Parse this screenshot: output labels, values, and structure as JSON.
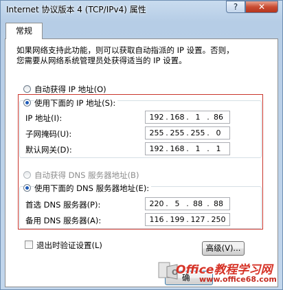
{
  "window": {
    "title": "Internet 协议版本 4 (TCP/IPv4) 属性",
    "help_label": "?",
    "close_label": "✕"
  },
  "tabs": [
    {
      "label": "常规"
    }
  ],
  "description": {
    "line1": "如果网络支持此功能，则可以获取自动指派的 IP 设置。否则，",
    "line2": "您需要从网络系统管理员处获得适当的 IP 设置。"
  },
  "ip_section": {
    "auto_label": "自动获得 IP 地址(O)",
    "manual_label": "使用下面的 IP 地址(S):",
    "selected": "manual",
    "fields": [
      {
        "label": "IP 地址(I):",
        "octets": [
          "192",
          "168",
          "1",
          "86"
        ]
      },
      {
        "label": "子网掩码(U):",
        "octets": [
          "255",
          "255",
          "255",
          "0"
        ]
      },
      {
        "label": "默认网关(D):",
        "octets": [
          "192",
          "168",
          "1",
          "1"
        ]
      }
    ]
  },
  "dns_section": {
    "auto_label": "自动获得 DNS 服务器地址(B)",
    "manual_label": "使用下面的 DNS 服务器地址(E):",
    "selected": "manual",
    "fields": [
      {
        "label": "首选 DNS 服务器(P):",
        "octets": [
          "220",
          "5",
          "88",
          "88"
        ]
      },
      {
        "label": "备用 DNS 服务器(A):",
        "octets": [
          "116",
          "199",
          "127",
          "250"
        ]
      }
    ]
  },
  "validate": {
    "label": "退出时验证设置(L)",
    "checked": false
  },
  "buttons": {
    "advanced": "高级(V)...",
    "ok_partial": "确"
  },
  "watermark": {
    "main": "Office教程学习网",
    "url": "www.office68.com"
  },
  "colors": {
    "highlight_border": "#c9342b",
    "radio_selected": "#1e5bb9",
    "watermark": "#d63327"
  }
}
